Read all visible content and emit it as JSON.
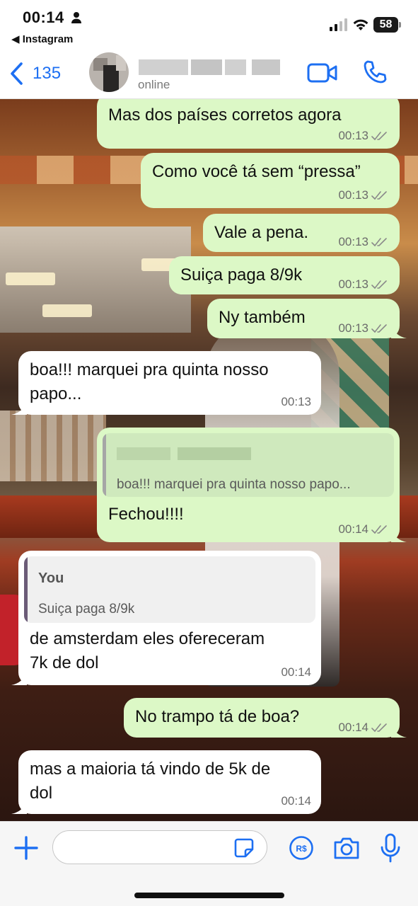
{
  "status_bar": {
    "time": "00:14",
    "back_app": "◀ Instagram",
    "battery": "58"
  },
  "header": {
    "back_count": "135",
    "contact_status": "online",
    "icons": [
      "chevron-left-icon",
      "video-camera-icon",
      "phone-icon"
    ]
  },
  "messages": [
    {
      "dir": "out",
      "text": "Mas dos países corretos agora",
      "time": "00:13"
    },
    {
      "dir": "out",
      "text": "Como você tá sem “pressa”",
      "time": "00:13"
    },
    {
      "dir": "out",
      "text": "Vale a pena.",
      "time": "00:13"
    },
    {
      "dir": "out",
      "text": "Suiça paga 8/9k",
      "time": "00:13"
    },
    {
      "dir": "out",
      "text": "Ny também",
      "time": "00:13"
    },
    {
      "dir": "in",
      "text_line1": "boa!!! marquei pra quinta nosso",
      "text_line2": "papo...",
      "time": "00:13"
    },
    {
      "dir": "out",
      "quote_text": "boa!!! marquei pra quinta nosso papo...",
      "text": "Fechou!!!!",
      "time": "00:14"
    },
    {
      "dir": "in",
      "quote_author": "You",
      "quote_text": "Suiça paga 8/9k",
      "text_line1": "de amsterdam eles ofereceram",
      "text_line2": "7k de dol",
      "time": "00:14"
    },
    {
      "dir": "out",
      "text": "No trampo tá de boa?",
      "time": "00:14"
    },
    {
      "dir": "in",
      "text_line1": "mas a maioria tá vindo de 5k de",
      "text_line2": "dol",
      "time": "00:14"
    }
  ],
  "input_bar": {
    "message_value": "",
    "icons": [
      "plus-icon",
      "sticker-icon",
      "pix-payment-icon",
      "camera-icon",
      "microphone-icon"
    ]
  },
  "colors": {
    "outgoing_bubble": "#dcf8c6",
    "incoming_bubble": "#ffffff",
    "accent_blue": "#1d6ff2"
  }
}
